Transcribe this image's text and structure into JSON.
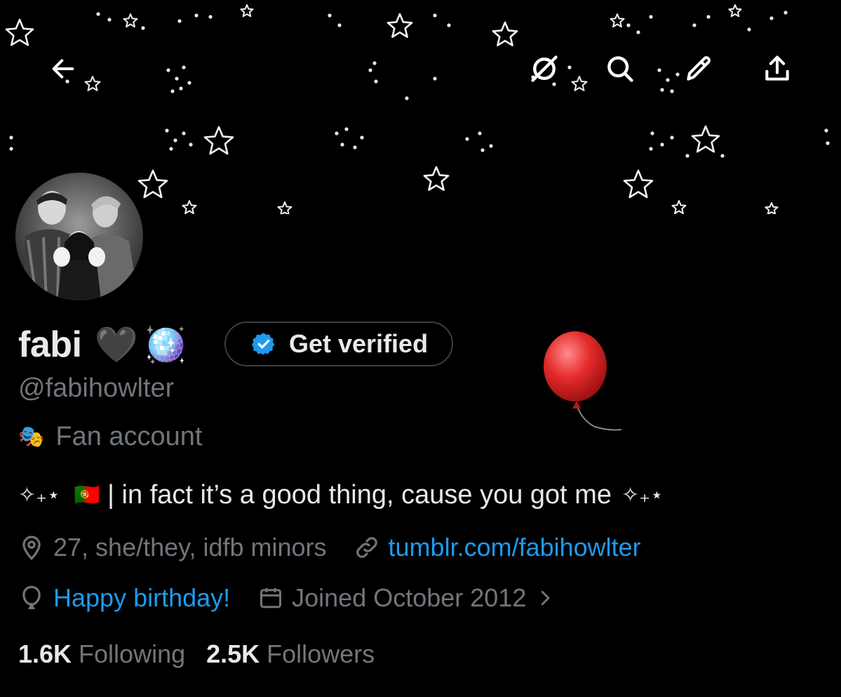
{
  "header": {
    "back_icon": "arrow-left-icon",
    "actions": [
      "circle-slash-icon",
      "search-icon",
      "pencil-icon",
      "share-upload-icon"
    ]
  },
  "banner": {
    "description_icon": "stars-pattern"
  },
  "profile": {
    "display_name": "fabi",
    "name_emoji_1": "🖤",
    "name_emoji_2": "🪩",
    "get_verified_label": "Get verified",
    "handle": "@fabihowlter",
    "category_emoji": "🎭",
    "category": "Fan account",
    "bio_prefix": "✧₊⋆",
    "bio_flag": "🇵🇹",
    "bio_text": "| in fact it’s a good thing, cause you got me",
    "bio_suffix": "✧₊⋆",
    "location": "27, she/they, idfb minors",
    "website": "tumblr.com/fabihowlter",
    "birthday": "Happy birthday!",
    "joined": "Joined October 2012",
    "following_count": "1.6K",
    "following_label": "Following",
    "followers_count": "2.5K",
    "followers_label": "Followers",
    "balloon_emoji": "🎈"
  },
  "colors": {
    "background": "#000000",
    "text_primary": "#e7e9ea",
    "text_secondary": "#71767b",
    "accent_link": "#1d9bf0",
    "verified_badge": "#1d9bf0"
  }
}
